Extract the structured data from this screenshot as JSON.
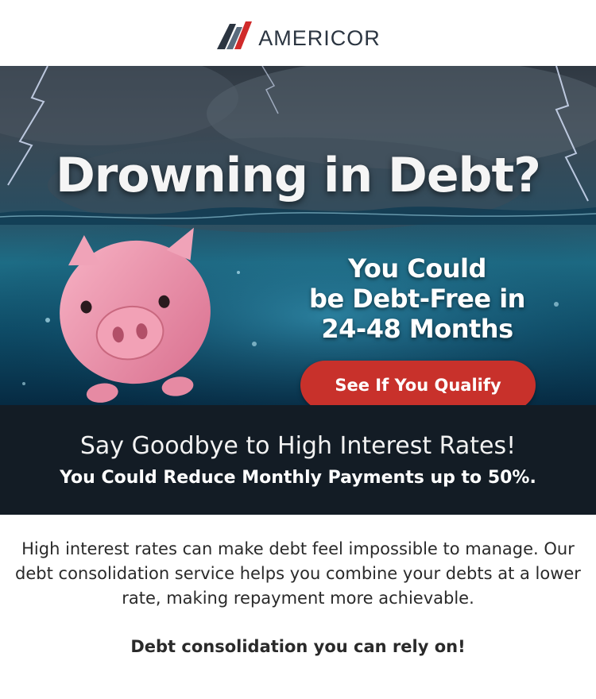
{
  "brand": {
    "name": "AMERICOR",
    "colors": {
      "navy": "#2b3541",
      "slate": "#5a6b7d",
      "red": "#d02a2a"
    }
  },
  "hero": {
    "headline": "Drowning in Debt?",
    "subline": [
      "You Could",
      "be Debt-Free in",
      "24-48 Months"
    ],
    "cta_label": "See If You Qualify",
    "cta_color": "#c8312b",
    "image_subject": "piggy-bank-sinking-in-stormy-sea"
  },
  "band": {
    "title": "Say Goodbye to High Interest Rates!",
    "subtitle": "You Could Reduce Monthly Payments up to 50%.",
    "background": "#131c25"
  },
  "body": {
    "description": "High interest rates can make debt feel impossible to manage. Our debt consolidation service helps you combine your debts at a lower rate, making repayment more achievable.",
    "tagline": "Debt consolidation you can rely on!"
  }
}
